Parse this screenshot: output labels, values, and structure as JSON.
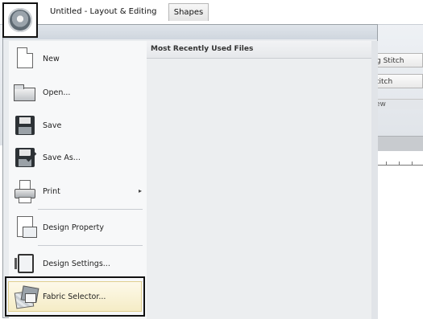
{
  "app": {
    "document_tab": "Untitled - Layout & Editing",
    "shapes_tab": "Shapes"
  },
  "ribbon": {
    "items": [
      "g Stitch",
      "titch",
      "ew"
    ]
  },
  "file_menu": {
    "items": [
      {
        "label": "New",
        "icon": "new-document-icon"
      },
      {
        "label": "Open...",
        "icon": "open-folder-icon"
      },
      {
        "label": "Save",
        "icon": "save-floppy-icon"
      },
      {
        "label": "Save As...",
        "icon": "save-as-icon"
      },
      {
        "label": "Print",
        "icon": "printer-icon",
        "has_submenu": true
      },
      {
        "label": "Design Property",
        "icon": "design-property-icon"
      },
      {
        "label": "Design Settings...",
        "icon": "design-settings-icon"
      },
      {
        "label": "Fabric Selector...",
        "icon": "fabric-selector-icon"
      }
    ],
    "mru_header": "Most Recently Used Files",
    "submenu_arrow": "▸"
  }
}
